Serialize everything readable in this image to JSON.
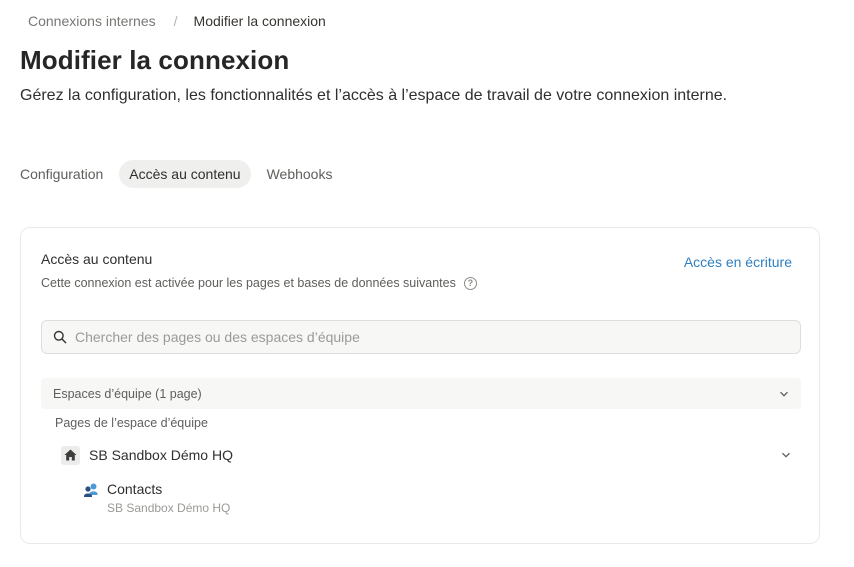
{
  "breadcrumb": {
    "parent": "Connexions internes",
    "separator": "/",
    "current": "Modifier la connexion"
  },
  "header": {
    "title": "Modifier la connexion",
    "subtitle": "Gérez la configuration, les fonctionnalités et l’accès à l’espace de travail de votre connexion interne."
  },
  "tabs": [
    {
      "label": "Configuration",
      "active": false
    },
    {
      "label": "Accès au contenu",
      "active": true
    },
    {
      "label": "Webhooks",
      "active": false
    }
  ],
  "content_access": {
    "title": "Accès au contenu",
    "description": "Cette connexion est activée pour les pages et bases de données suivantes",
    "help_glyph": "?",
    "write_access_label": "Accès en écriture",
    "search": {
      "placeholder": "Chercher des pages ou des espaces d’équipe",
      "value": ""
    },
    "section": {
      "label": "Espaces d’équipe (1 page)",
      "sublabel": "Pages de l’espace d’équipe"
    },
    "workspace": {
      "name": "SB Sandbox Démo HQ",
      "icon": "home-icon"
    },
    "pages": [
      {
        "name": "Contacts",
        "parent": "SB Sandbox Démo HQ",
        "icon": "contacts-people-icon"
      }
    ]
  },
  "colors": {
    "accent_link": "#2f7fc1",
    "active_tab_bg": "#efefed",
    "border": "#e9e9e7"
  }
}
